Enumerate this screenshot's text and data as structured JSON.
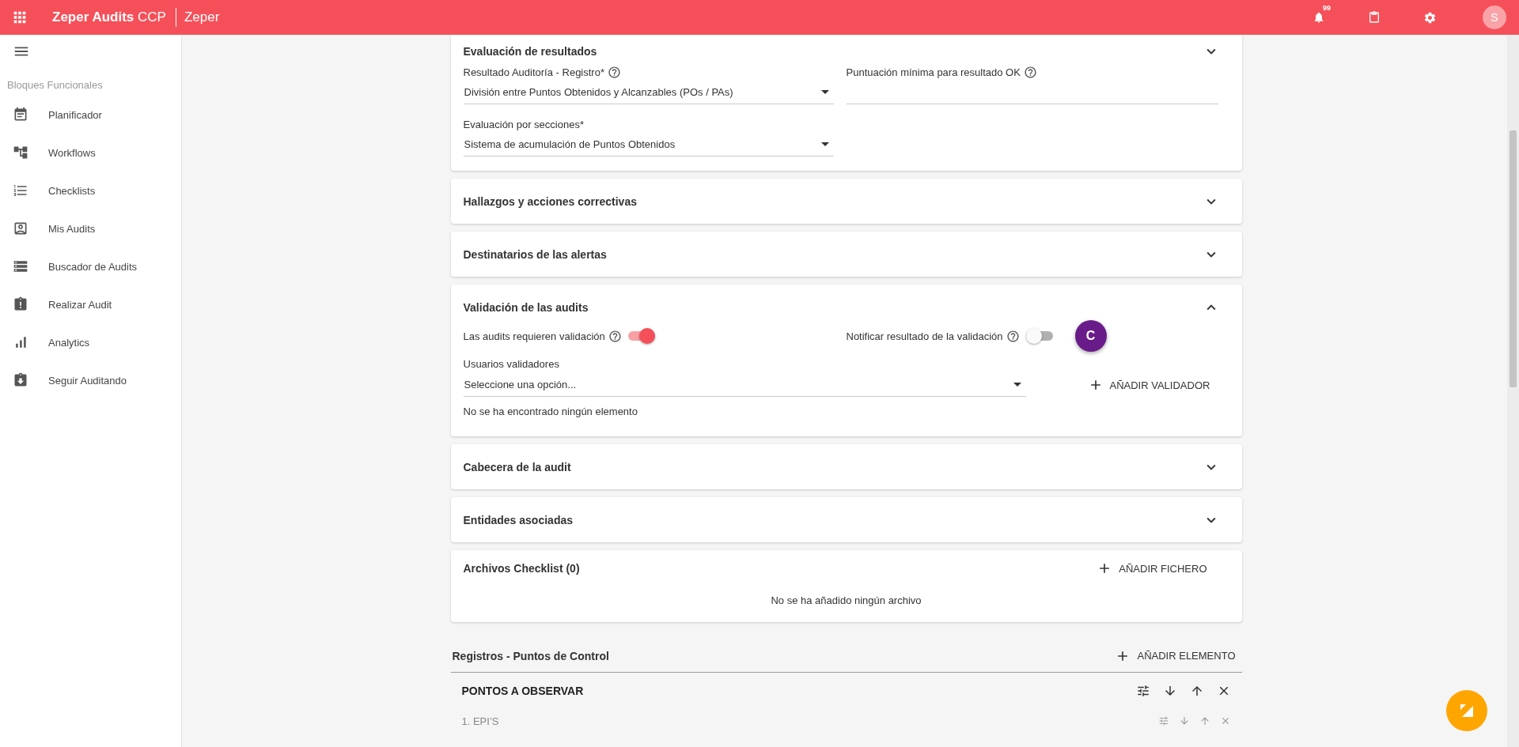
{
  "app_bar": {
    "title": "Zeper Audits",
    "title_suffix": "CCP",
    "org": "Zeper",
    "notification_count": "99",
    "avatar_initial": "S"
  },
  "sidebar": {
    "section_label": "Bloques Funcionales",
    "items": [
      {
        "label": "Planificador"
      },
      {
        "label": "Workflows"
      },
      {
        "label": "Checklists"
      },
      {
        "label": "Mis Audits"
      },
      {
        "label": "Buscador de Audits"
      },
      {
        "label": "Realizar Audit"
      },
      {
        "label": "Analytics"
      },
      {
        "label": "Seguir Auditando"
      }
    ]
  },
  "sections": [
    {
      "kind": "evaluation",
      "title": "Evaluación de resultados",
      "fields": [
        {
          "kind": "select",
          "label": "Resultado Auditoría - Registro*",
          "help": true,
          "value": "División entre Puntos Obtenidos y Alcanzables (POs / PAs)"
        },
        {
          "kind": "input",
          "label": "Puntuación mínima para resultado OK",
          "help": true
        },
        {
          "kind": "select",
          "label": "Evaluación por secciones*",
          "value": "Sistema de acumulación de Puntos Obtenidos"
        }
      ]
    },
    {
      "kind": "collapsed",
      "title": "Hallazgos y acciones correctivas"
    },
    {
      "kind": "collapsed",
      "title": "Destinatarios de las alertas"
    },
    {
      "kind": "validation",
      "title": "Validación de las audits",
      "toggles": [
        {
          "label": "Las audits requieren validación",
          "on": true
        },
        {
          "label": "Notificar resultado de la validación",
          "on": false
        }
      ],
      "badge": "C",
      "select_label": "Usuarios validadores",
      "placeholder": "Seleccione una opción...",
      "add_label": "AÑADIR VALIDADOR",
      "empty_text": "No se ha encontrado ningún elemento"
    },
    {
      "kind": "collapsed",
      "title": "Cabecera de la audit"
    },
    {
      "kind": "collapsed",
      "title": "Entidades asociadas"
    },
    {
      "kind": "files",
      "title": "Archivos Checklist (0)",
      "add_label": "AÑADIR FICHERO",
      "empty_text": "No se ha añadido ningún archivo"
    }
  ],
  "registros": {
    "title": "Registros - Puntos de Control",
    "add_label": "AÑADIR ELEMENTO",
    "groups": [
      {
        "title": "PONTOS A OBSERVAR",
        "items": [
          {
            "label": "1. EPI’S"
          }
        ]
      }
    ]
  }
}
